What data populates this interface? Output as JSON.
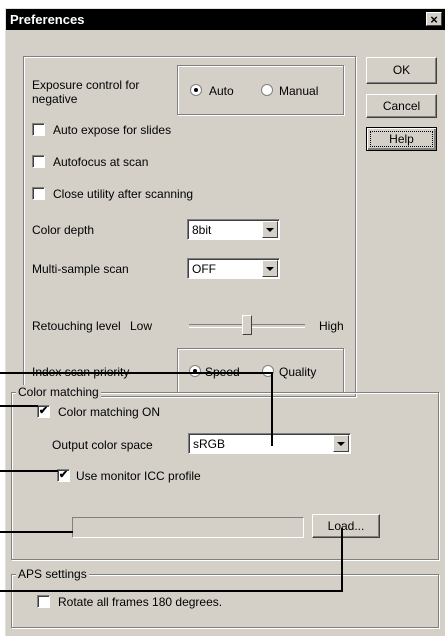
{
  "dialog": {
    "title": "Preferences",
    "close_glyph": "×"
  },
  "buttons": {
    "ok": "OK",
    "cancel": "Cancel",
    "help": "Help",
    "load": "Load..."
  },
  "exposure": {
    "label": "Exposure control for negative",
    "options": [
      "Auto",
      "Manual"
    ],
    "selected": "Auto"
  },
  "checks": {
    "auto_expose": {
      "label": "Auto expose for slides",
      "checked": false
    },
    "autofocus": {
      "label": "Autofocus at scan",
      "checked": false
    },
    "close_utility": {
      "label": "Close utility after scanning",
      "checked": false
    }
  },
  "color_depth": {
    "label": "Color depth",
    "value": "8bit"
  },
  "multisample": {
    "label": "Multi-sample scan",
    "value": "OFF"
  },
  "retouching": {
    "label": "Retouching level",
    "low": "Low",
    "high": "High",
    "level": 0.5
  },
  "index_priority": {
    "label": "Index scan priority",
    "options": [
      "Speed",
      "Quality"
    ],
    "selected": "Speed"
  },
  "color_matching": {
    "group_label": "Color matching",
    "on": {
      "label": "Color matching ON",
      "checked": true
    },
    "output_label": "Output color space",
    "output_value": "sRGB",
    "monitor_icc": {
      "label": "Use monitor ICC profile",
      "checked": true
    },
    "profile_path": ""
  },
  "aps": {
    "group_label": "APS settings",
    "rotate": {
      "label": "Rotate all frames 180 degrees.",
      "checked": false
    }
  },
  "glyphs": {
    "check": "✔"
  }
}
